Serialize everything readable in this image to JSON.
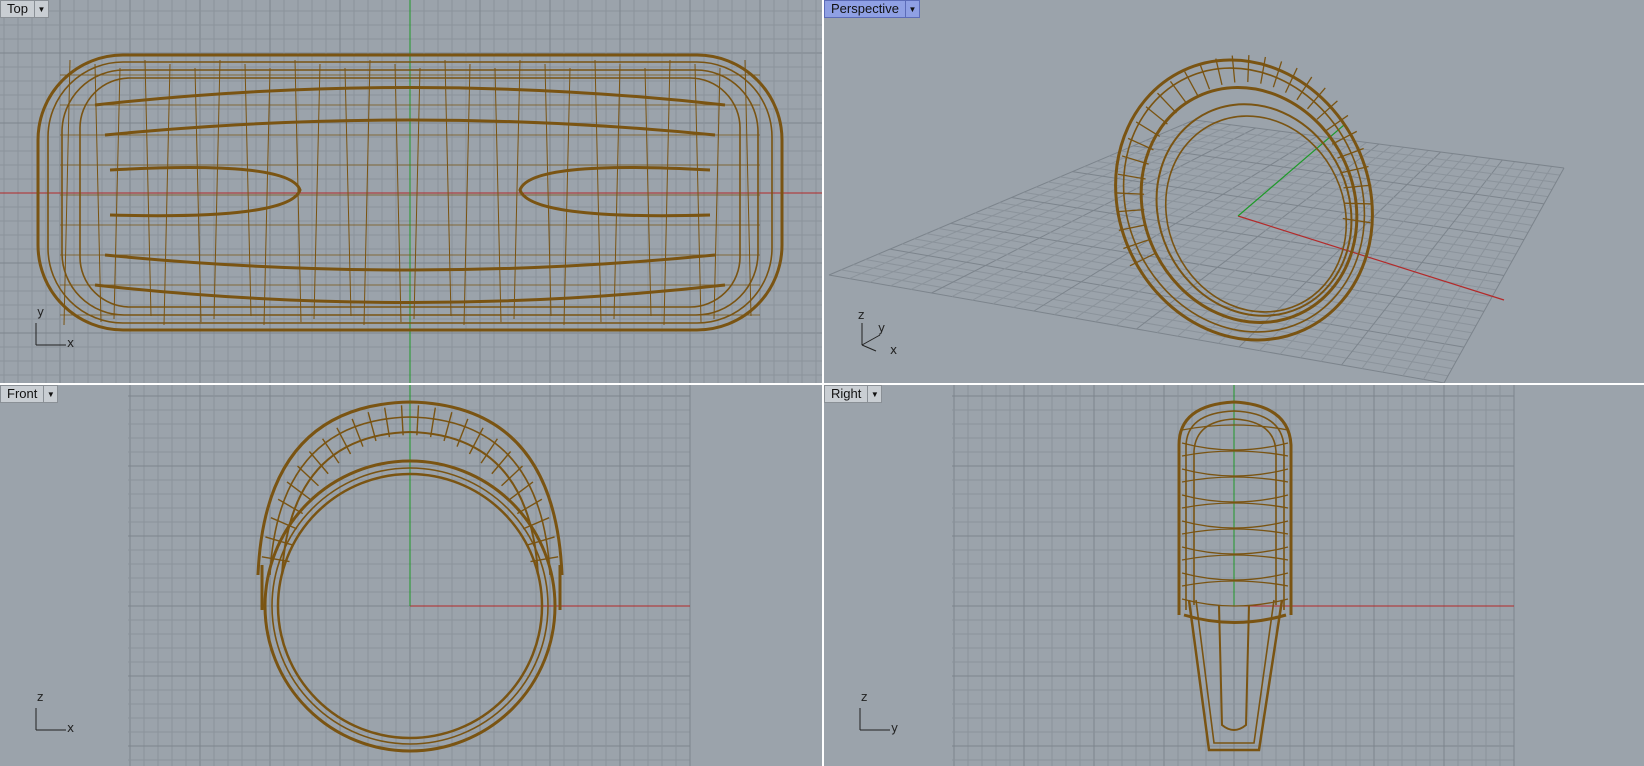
{
  "viewports": {
    "top": {
      "name": "Top",
      "active": false,
      "axis_h": "x",
      "axis_v": "y"
    },
    "perspective": {
      "name": "Perspective",
      "active": true,
      "axis_1": "z",
      "axis_2": "y",
      "axis_3": "x"
    },
    "front": {
      "name": "Front",
      "active": false,
      "axis_h": "x",
      "axis_v": "z"
    },
    "right": {
      "name": "Right",
      "active": false,
      "axis_h": "y",
      "axis_v": "z"
    }
  },
  "icons": {
    "dropdown": "dropdown-arrow-icon"
  },
  "colors": {
    "viewport_bg": "#9ba3ab",
    "grid": "#8b939b",
    "grid_major": "#7c848c",
    "x_axis": "#b32a2a",
    "y_axis": "#1f9a2a",
    "wireframe": "#7a5412",
    "active_tab": "#8fa0e4"
  }
}
